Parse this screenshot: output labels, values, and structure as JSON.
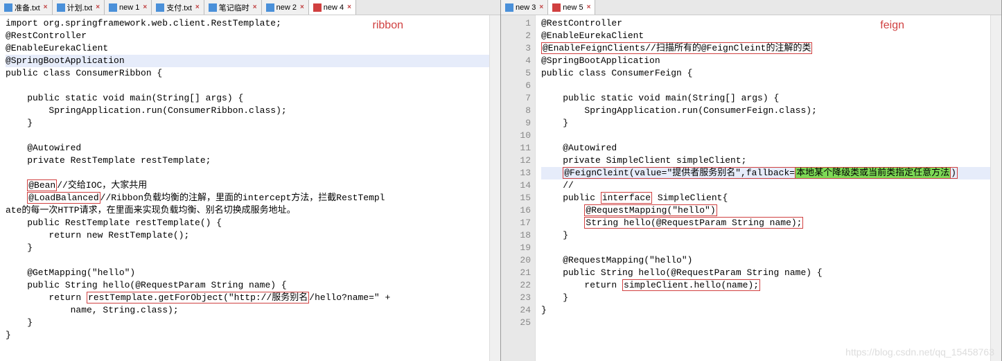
{
  "left": {
    "tabs": [
      {
        "label": "准备.txt",
        "icon": "blue",
        "active": false
      },
      {
        "label": "计划.txt",
        "icon": "blue",
        "active": false
      },
      {
        "label": "new 1",
        "icon": "blue",
        "active": false
      },
      {
        "label": "支付.txt",
        "icon": "blue",
        "active": false
      },
      {
        "label": "笔记临时",
        "icon": "blue",
        "active": false
      },
      {
        "label": "new 2",
        "icon": "blue",
        "active": false
      },
      {
        "label": "new 4",
        "icon": "red",
        "active": true
      }
    ],
    "label": "ribbon",
    "code": [
      "import org.springframework.web.client.RestTemplate;",
      "@RestController",
      "@EnableEurekaClient",
      "@SpringBootApplication",
      "public class ConsumerRibbon {",
      "",
      "    public static void main(String[] args) {",
      "        SpringApplication.run(ConsumerRibbon.class);",
      "    }",
      "",
      "    @Autowired",
      "    private RestTemplate restTemplate;",
      "",
      "    @Bean//交给IOC，大家共用",
      "    @LoadBalanced//Ribbon负载均衡的注解，里面的intercept方法，拦截RestTempl",
      "ate的每一次HTTP请求，在里面来实现负载均衡、别名切换成服务地址。",
      "    public RestTemplate restTemplate() {",
      "        return new RestTemplate();",
      "    }",
      "",
      "    @GetMapping(\"hello\")",
      "    public String hello(@RequestParam String name) {",
      "        return restTemplate.getForObject(\"http://服务别名/hello?name=\" +",
      "            name, String.class);",
      "    }",
      "}"
    ],
    "highlightLine": 3,
    "redboxes": {
      "13": {
        "parts": [
          "    ",
          "@Bean",
          "//交给IOC，大家共用"
        ]
      },
      "14": {
        "parts": [
          "    ",
          "@LoadBalanced",
          "//Ribbon负载均衡的注解，里面的intercept方法，拦截RestTempl"
        ]
      },
      "22": {
        "parts": [
          "        return ",
          "restTemplate.getForObject(\"http://服务别名",
          "/hello?name=\" +"
        ]
      }
    }
  },
  "right": {
    "tabs": [
      {
        "label": "new 3",
        "icon": "blue",
        "active": false
      },
      {
        "label": "new 5",
        "icon": "red",
        "active": true
      }
    ],
    "label": "feign",
    "lineStart": 1,
    "lineEnd": 25,
    "code": [
      "@RestController",
      "@EnableEurekaClient",
      "@EnableFeignClients//扫描所有的@FeignCleint的注解的类",
      "@SpringBootApplication",
      "public class ConsumerFeign {",
      "",
      "    public static void main(String[] args) {",
      "        SpringApplication.run(ConsumerFeign.class);",
      "    }",
      "",
      "    @Autowired",
      "    private SimpleClient simpleClient;",
      "    @FeignCleint(value=\"提供者服务别名\",fallback=本地某个降级类或当前类指定任意方法)",
      "    //",
      "    public interface SimpleClient{",
      "        @RequestMapping(\"hello\")",
      "        String hello(@RequestParam String name);",
      "    }",
      "",
      "    @RequestMapping(\"hello\")",
      "    public String hello(@RequestParam String name) {",
      "        return simpleClient.hello(name);",
      "    }",
      "}",
      ""
    ],
    "highlightLine": 12,
    "watermark": "https://blog.csdn.net/qq_15458763"
  }
}
